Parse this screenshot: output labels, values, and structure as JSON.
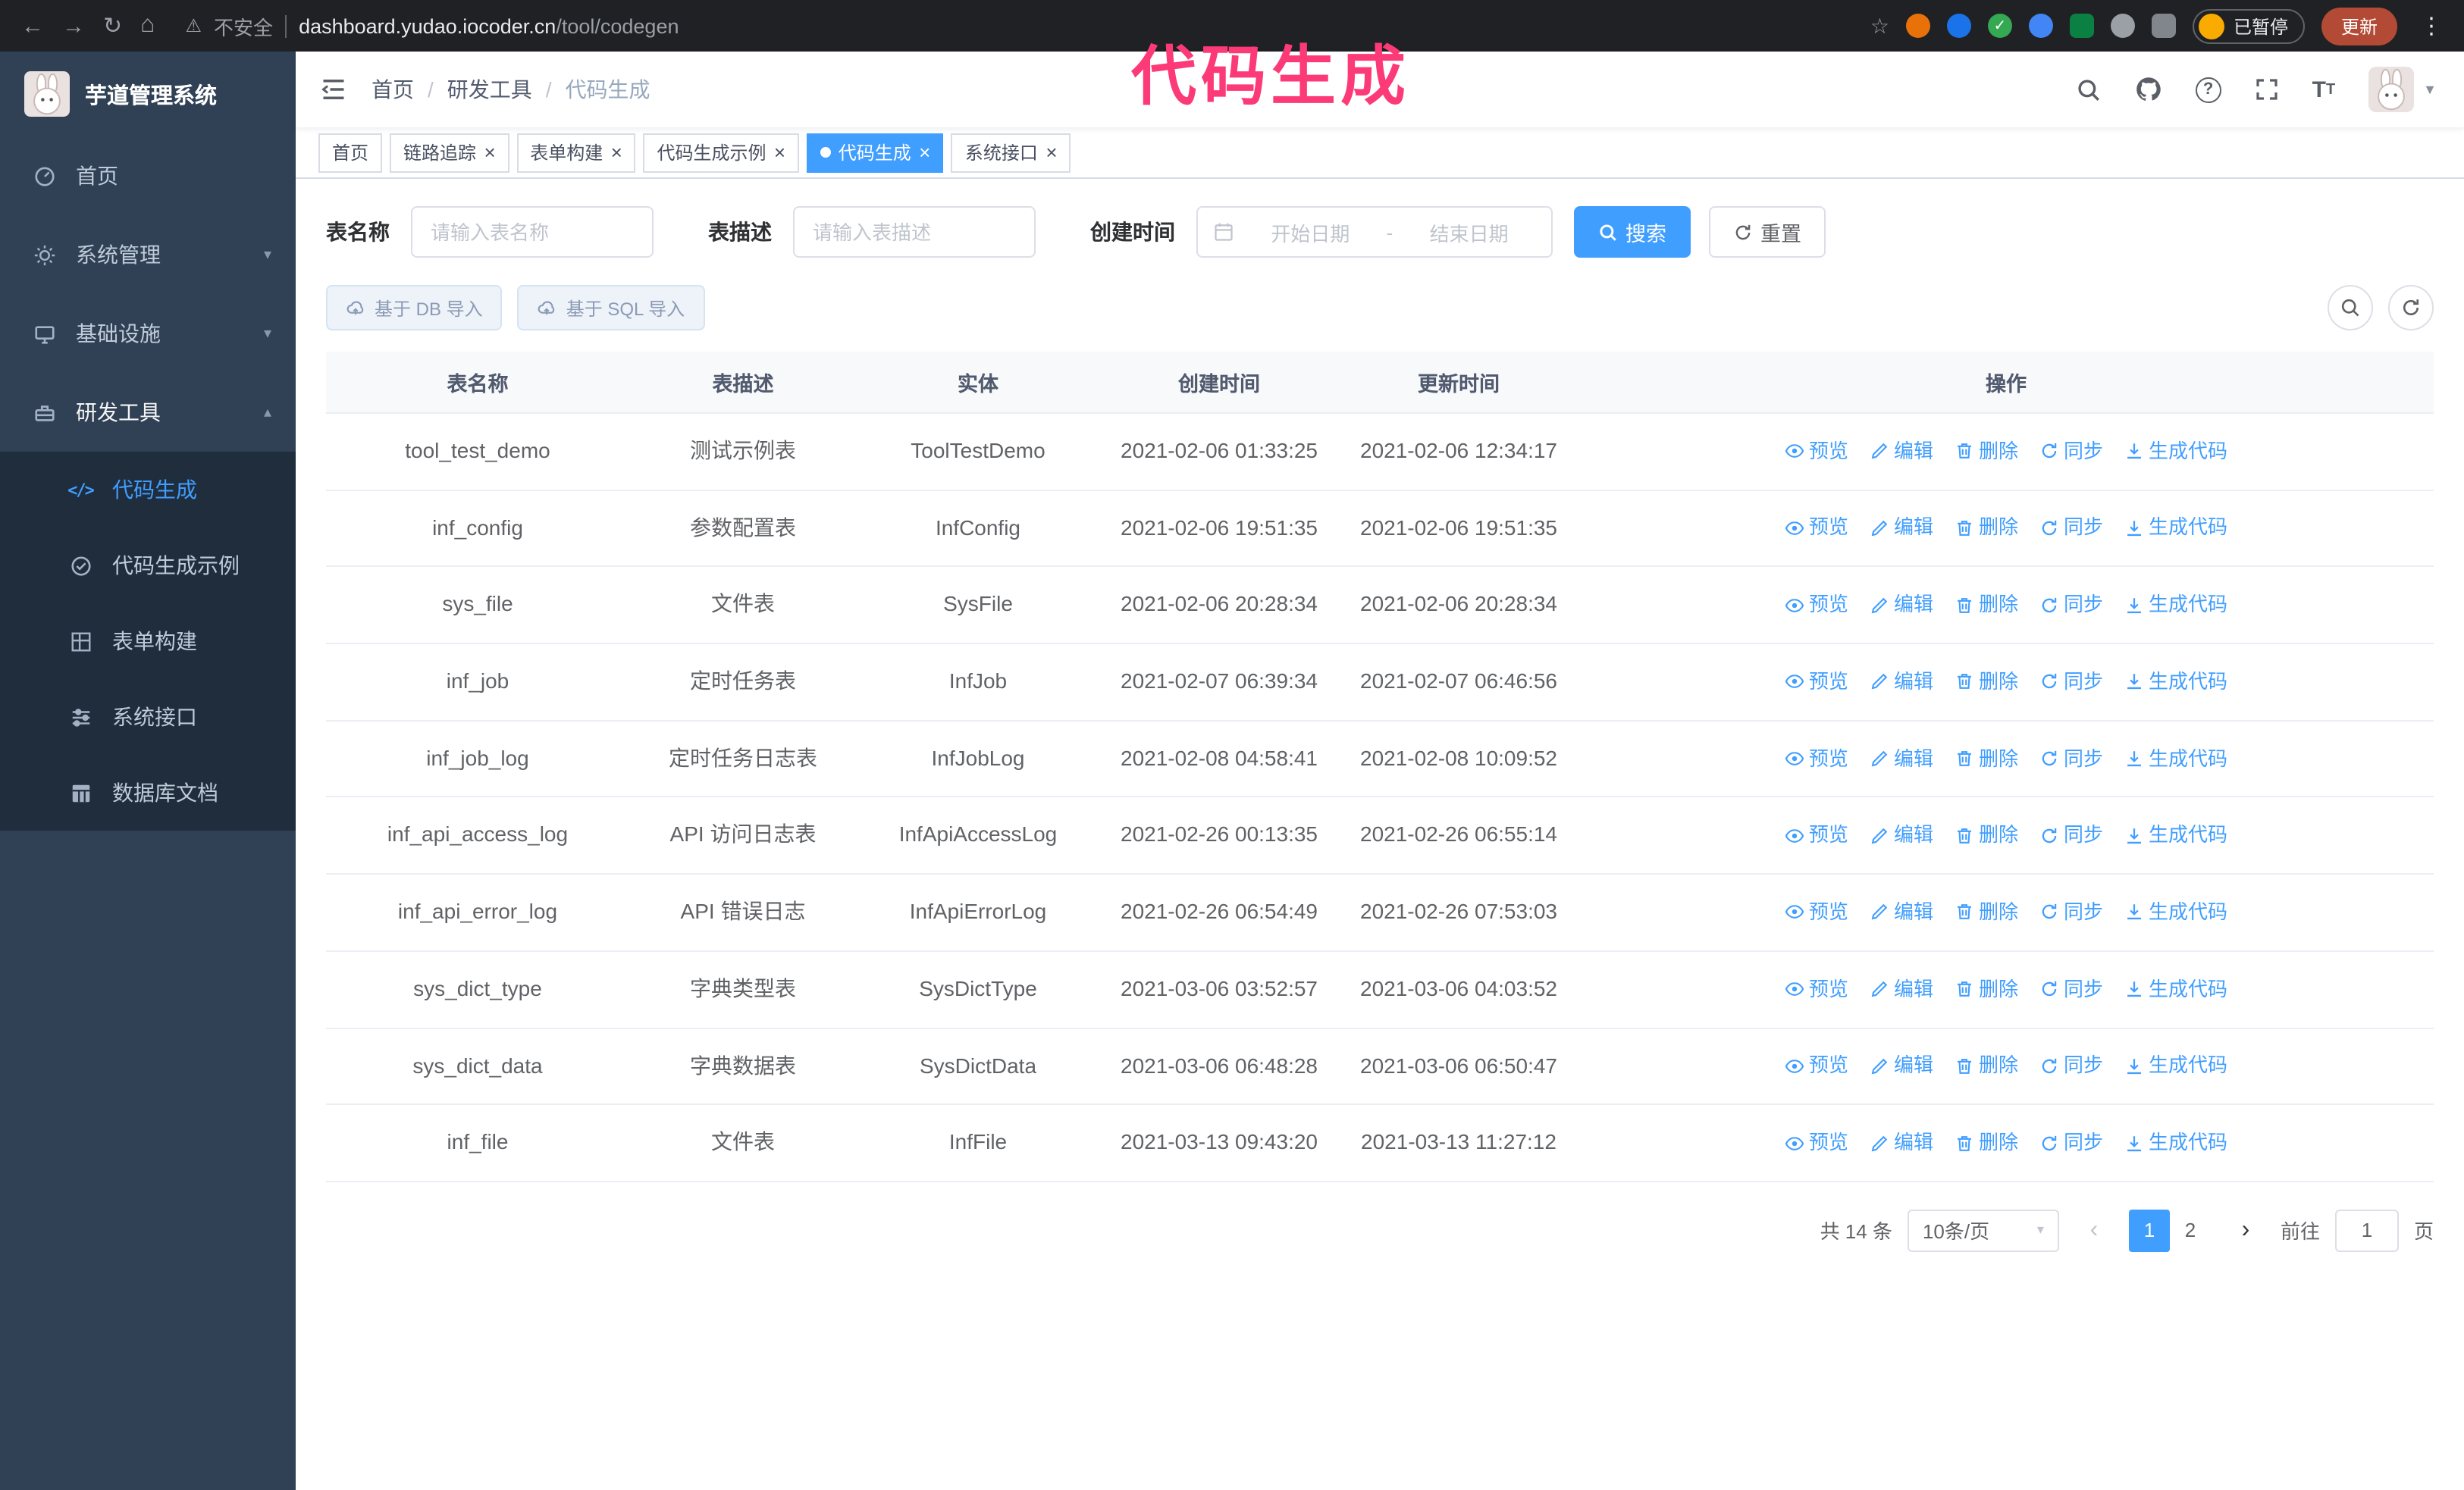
{
  "browser": {
    "security_warning": "不安全",
    "url_host": "dashboard.yudao.iocoder.cn",
    "url_path": "/tool/codegen",
    "paused_badge": "已暂停",
    "update_button": "更新"
  },
  "icons": {
    "back": "←",
    "forward": "→",
    "refresh": "↻",
    "home": "⌂",
    "warning": "⚠",
    "star": "☆",
    "kebab": "⋮",
    "close": "×",
    "chevron_down": "▾",
    "chevron_up": "▴",
    "caret_down": "▼",
    "breadcrumb_separator": "/",
    "prev": "‹",
    "next": "›",
    "green_check": "✓"
  },
  "overlay": {
    "title": "代码生成",
    "color": "#fb3a77"
  },
  "sidebar": {
    "app_title": "芋道管理系统",
    "items": [
      {
        "label": "首页"
      },
      {
        "label": "系统管理",
        "expanded": false
      },
      {
        "label": "基础设施",
        "expanded": false
      },
      {
        "label": "研发工具",
        "expanded": true,
        "children": [
          {
            "label": "代码生成",
            "active": true
          },
          {
            "label": "代码生成示例"
          },
          {
            "label": "表单构建"
          },
          {
            "label": "系统接口"
          },
          {
            "label": "数据库文档"
          }
        ]
      }
    ]
  },
  "header": {
    "breadcrumb": [
      "首页",
      "研发工具",
      "代码生成"
    ]
  },
  "tabs": [
    {
      "label": "首页",
      "closable": false,
      "active": false
    },
    {
      "label": "链路追踪",
      "closable": true,
      "active": false
    },
    {
      "label": "表单构建",
      "closable": true,
      "active": false
    },
    {
      "label": "代码生成示例",
      "closable": true,
      "active": false
    },
    {
      "label": "代码生成",
      "closable": true,
      "active": true
    },
    {
      "label": "系统接口",
      "closable": true,
      "active": false
    }
  ],
  "filters": {
    "table_name_label": "表名称",
    "table_name_placeholder": "请输入表名称",
    "table_desc_label": "表描述",
    "table_desc_placeholder": "请输入表描述",
    "create_time_label": "创建时间",
    "date_start_placeholder": "开始日期",
    "date_separator": "-",
    "date_end_placeholder": "结束日期",
    "search_button": "搜索",
    "reset_button": "重置"
  },
  "toolbar": {
    "import_db_button": "基于 DB 导入",
    "import_sql_button": "基于 SQL 导入"
  },
  "table": {
    "columns": [
      "表名称",
      "表描述",
      "实体",
      "创建时间",
      "更新时间",
      "操作"
    ],
    "actions": [
      "预览",
      "编辑",
      "删除",
      "同步",
      "生成代码"
    ],
    "rows": [
      {
        "name": "tool_test_demo",
        "desc": "测试示例表",
        "entity": "ToolTestDemo",
        "created": "2021-02-06 01:33:25",
        "updated": "2021-02-06 12:34:17"
      },
      {
        "name": "inf_config",
        "desc": "参数配置表",
        "entity": "InfConfig",
        "created": "2021-02-06 19:51:35",
        "updated": "2021-02-06 19:51:35"
      },
      {
        "name": "sys_file",
        "desc": "文件表",
        "entity": "SysFile",
        "created": "2021-02-06 20:28:34",
        "updated": "2021-02-06 20:28:34"
      },
      {
        "name": "inf_job",
        "desc": "定时任务表",
        "entity": "InfJob",
        "created": "2021-02-07 06:39:34",
        "updated": "2021-02-07 06:46:56"
      },
      {
        "name": "inf_job_log",
        "desc": "定时任务日志表",
        "entity": "InfJobLog",
        "created": "2021-02-08 04:58:41",
        "updated": "2021-02-08 10:09:52"
      },
      {
        "name": "inf_api_access_log",
        "desc": "API 访问日志表",
        "entity": "InfApiAccessLog",
        "created": "2021-02-26 00:13:35",
        "updated": "2021-02-26 06:55:14"
      },
      {
        "name": "inf_api_error_log",
        "desc": "API 错误日志",
        "entity": "InfApiErrorLog",
        "created": "2021-02-26 06:54:49",
        "updated": "2021-02-26 07:53:03"
      },
      {
        "name": "sys_dict_type",
        "desc": "字典类型表",
        "entity": "SysDictType",
        "created": "2021-03-06 03:52:57",
        "updated": "2021-03-06 04:03:52"
      },
      {
        "name": "sys_dict_data",
        "desc": "字典数据表",
        "entity": "SysDictData",
        "created": "2021-03-06 06:48:28",
        "updated": "2021-03-06 06:50:47"
      },
      {
        "name": "inf_file",
        "desc": "文件表",
        "entity": "InfFile",
        "created": "2021-03-13 09:43:20",
        "updated": "2021-03-13 11:27:12"
      }
    ]
  },
  "pagination": {
    "total": "共 14 条",
    "page_size": "10条/页",
    "pages": [
      "1",
      "2"
    ],
    "current": "1",
    "goto_label": "前往",
    "goto_value": "1",
    "goto_suffix": "页"
  },
  "colors": {
    "accent": "#409eff",
    "sidebar_bg": "#304156",
    "submenu_bg": "#1f2d3d",
    "overlay_pink": "#fb3a77",
    "chrome_bg": "#202124"
  }
}
